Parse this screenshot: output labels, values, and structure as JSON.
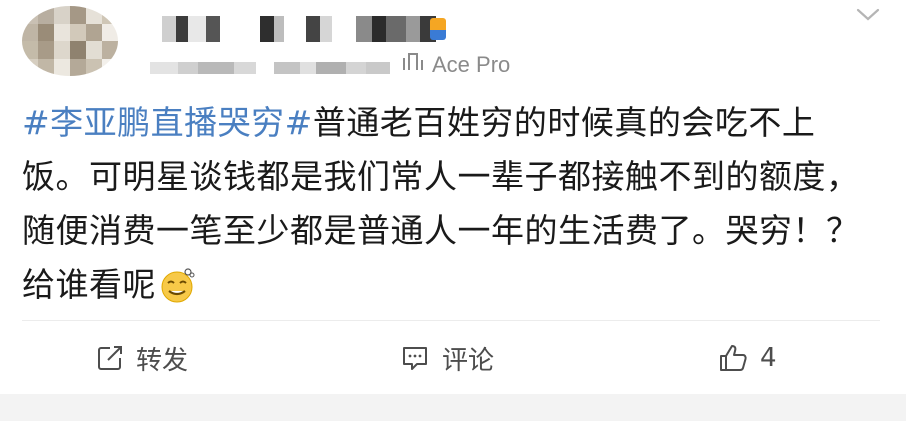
{
  "post": {
    "device": "Ace Pro",
    "device_icon": "phone-device-icon",
    "hashtag": "#李亚鹏直播哭穷#",
    "body": "普通老百姓穷的时候真的会吃不上饭。可明星谈钱都是我们常人一辈子都接触不到的额度，随便消费一笔至少都是普通人一年的生活费了。哭穷！？给谁看呢",
    "emoji": "dizzy-smile-emoji"
  },
  "actions": {
    "repost_label": "转发",
    "comment_label": "评论",
    "like_count": "4"
  },
  "colors": {
    "hashtag": "#4a7fc1",
    "text": "#1a1a1a",
    "meta": "#8a8a8a",
    "action": "#4d4d4d"
  }
}
